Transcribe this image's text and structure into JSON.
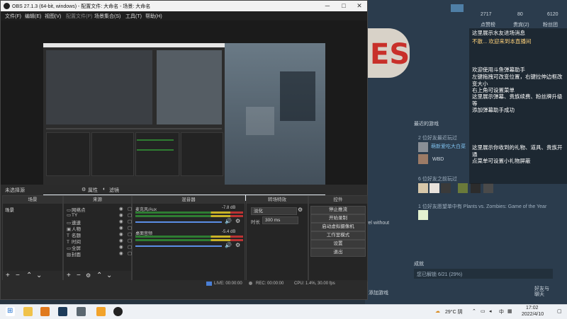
{
  "obs": {
    "title": "OBS 27.1.3 (64-bit, windows) - 配置文件: 大命名 - 场景: 大命名",
    "menu": [
      "文件(F)",
      "编辑(E)",
      "视图(V)",
      "配置文件(P)",
      "场景集合(S)",
      "工具(T)",
      "帮助(H)"
    ],
    "scene_label": "未选择源",
    "props_btn": "属性",
    "filters_btn": "滤镜",
    "docks": {
      "scenes": {
        "title": "场景",
        "items": [
          "场景"
        ]
      },
      "sources": {
        "title": "来源",
        "items": [
          {
            "icon": "monitor-icon",
            "label": "网络点"
          },
          {
            "icon": "monitor-icon",
            "label": "TY"
          },
          {
            "icon": "monitor-icon",
            "label": "速速"
          },
          {
            "icon": "window-icon",
            "label": "人物"
          },
          {
            "icon": "text-icon",
            "label": "名题"
          },
          {
            "icon": "text-icon",
            "label": "时间"
          },
          {
            "icon": "monitor-icon",
            "label": "全屏"
          },
          {
            "icon": "image-icon",
            "label": "封面"
          }
        ]
      },
      "mixer": {
        "title": "混音器",
        "channels": [
          {
            "name": "麦克风/Aux",
            "db": "-7.8 dB"
          },
          {
            "name": "桌面音频",
            "db": "-5.4 dB"
          }
        ]
      },
      "transitions": {
        "title": "转场特效",
        "type": "淡化",
        "duration_label": "时长",
        "duration_value": "300 ms"
      },
      "controls": {
        "title": "控件",
        "buttons": [
          "停止推流",
          "开始录制",
          "启动虚拟摄像机",
          "工作室模式",
          "设置",
          "退出"
        ]
      }
    },
    "status": {
      "live": "LIVE: 00:00:00",
      "rec": "REC: 00:00:00",
      "cpu": "CPU: 1.4%, 30.00 fps"
    }
  },
  "steam": {
    "stats": [
      {
        "value": "2717",
        "label": "点赞榜"
      },
      {
        "value": "80",
        "label": "贵宾(2)"
      },
      {
        "value": "6120",
        "label": "粉丝团"
      }
    ],
    "sections": {
      "recent_games": "最近的游戏",
      "friends_playing": "2 位好友最近玩过",
      "friends_want": "6 位好友之前玩过",
      "wishlist": "1 位好友愿望单中有 Plants vs. Zombies: Game of the Year",
      "achievements": "成就",
      "achievements_progress": "您已解锁 6/21 (29%)",
      "friend_name_1": "萌新爱吃大白菜",
      "friend_name_2": "WBD"
    },
    "overlay_text": "vel without",
    "friends_btn": "好友与\n聊天"
  },
  "chat": {
    "lines": [
      "这里展示水友进场消息",
      "不散... 欢迎来到本直播间",
      "欢迎使用斗鱼弹幕助手",
      "左键拖拽可改变位置，右键拉伸边框改变大小",
      "右上角可设置菜单",
      "这里展示弹幕、贵族续费、粉丝牌升级等",
      "添加弹幕助手成功",
      "这里展示你收到的礼物、道具、贵族开通",
      "点菜单可设置小礼物屏蔽"
    ]
  },
  "taskbar": {
    "weather": "29°C 阴",
    "ime": "中",
    "time": "17:02",
    "date": "2022/4/10",
    "add_game": "添加游戏"
  }
}
